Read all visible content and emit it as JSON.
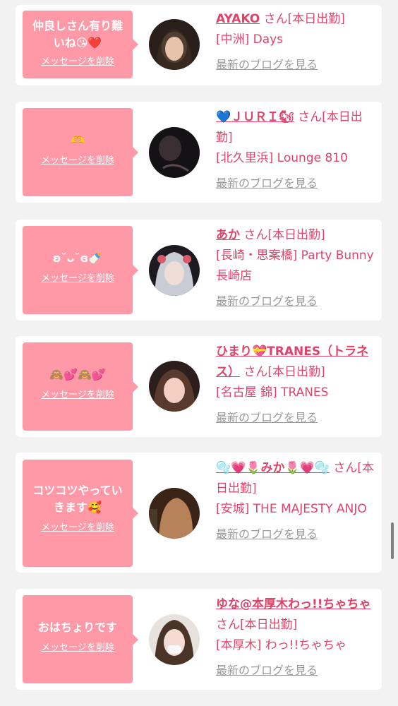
{
  "cards": [
    {
      "message": "仲良しさん有り難いね😘❤️",
      "delete_label": "メッセージを削除",
      "name": "AYAKO",
      "suffix": "さん[本日出勤]",
      "shop": "[中洲] Days",
      "blog_label": "最新のブログを見る"
    },
    {
      "message": "🫶",
      "delete_label": "メッセージを削除",
      "name": "💙ＪＵＲＩ🐿",
      "suffix": "さん[本日出勤]",
      "shop": "[北久里浜] Lounge 810",
      "blog_label": "最新のブログを見る"
    },
    {
      "message": "ʚ˘ᴗ˘ɞ🍼",
      "delete_label": "メッセージを削除",
      "name": "あか",
      "suffix": "さん[本日出勤]",
      "shop": "[長崎・思案橋] Party Bunny 長崎店",
      "blog_label": "最新のブログを見る"
    },
    {
      "message": "🙈💕🙈💕",
      "delete_label": "メッセージを削除",
      "name": "ひまり💝TRANES（トラネス）",
      "suffix": "さん[本日出勤]",
      "shop": "[名古屋 錦] TRANES",
      "blog_label": "最新のブログを見る"
    },
    {
      "message": "コツコツやっていきます🥰",
      "delete_label": "メッセージを削除",
      "name": "🫧💗🌷みか🌷💗🫧",
      "suffix": "さん[本日出勤]",
      "shop": "[安城] THE MAJESTY ANJO",
      "blog_label": "最新のブログを見る"
    },
    {
      "message": "おはちょりです",
      "delete_label": "メッセージを削除",
      "name": "ゆな@本厚木わっ!!ちゃちゃ",
      "suffix": "さん[本日出勤]",
      "shop": "[本厚木] わっ!!ちゃちゃ",
      "blog_label": "最新のブログを見る"
    }
  ],
  "colors": {
    "bubble": "#ff99a8",
    "name": "#e0436a",
    "link_gray": "#9a9a9a",
    "background": "#f2f2f2"
  },
  "icons": {
    "avatar": "profile-photo"
  }
}
